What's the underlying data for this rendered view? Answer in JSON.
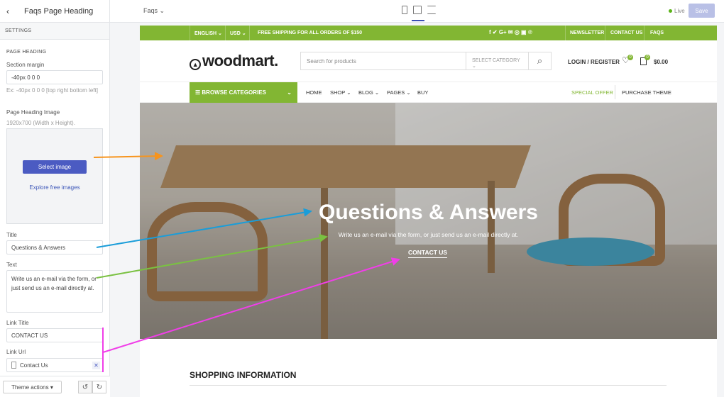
{
  "topbar": {
    "panel_title": "Faqs Page Heading",
    "page_selector": "Faqs",
    "live": "Live",
    "save": "Save"
  },
  "panel": {
    "settings": "SETTINGS",
    "section": "PAGE HEADING",
    "section_margin_label": "Section margin",
    "section_margin_value": "-40px 0 0 0",
    "section_margin_hint": "Ex: -40px 0 0 0 [top right bottom left]",
    "image_label": "Page Heading Image",
    "image_hint": "1920x700 (Width x Height).",
    "select_image": "Select image",
    "explore": "Explore free images",
    "title_label": "Title",
    "title_value": "Questions & Answers",
    "text_label": "Text",
    "text_value": "Write us an e-mail via the form, or just send us an e-mail directly at.",
    "link_title_label": "Link Title",
    "link_title_value": "CONTACT US",
    "link_url_label": "Link Url",
    "link_url_value": "Contact Us",
    "theme_actions": "Theme actions ▾"
  },
  "site": {
    "topbar": {
      "language": "ENGLISH ⌄",
      "currency": "USD ⌄",
      "shipping": "FREE SHIPPING FOR ALL ORDERS OF $150",
      "social": "f  ✔  G+  ✉  ◎  ▣  ℗",
      "links": [
        "NEWSLETTER",
        "CONTACT US",
        "FAQS"
      ]
    },
    "logo": "woodmart.",
    "search_placeholder": "Search for products",
    "category": "SELECT CATEGORY ⌄",
    "login": "LOGIN / REGISTER",
    "wishlist_count": "0",
    "cart_count": "0",
    "cart_total": "$0.00",
    "browse": "BROWSE CATEGORIES",
    "nav": [
      "HOME",
      "SHOP ⌄",
      "BLOG ⌄",
      "PAGES ⌄",
      "BUY"
    ],
    "special_offer": "SPECIAL OFFER",
    "purchase": "PURCHASE THEME",
    "hero": {
      "title": "Questions & Answers",
      "text": "Write us an e-mail via the form, or just send us an e-mail directly at.",
      "link": "CONTACT US"
    },
    "section_heading": "SHOPPING INFORMATION"
  },
  "colors": {
    "brand_green": "#82b633",
    "accent_blue": "#4b5bc2",
    "arrow_orange": "#f7941d",
    "arrow_blue": "#1a9dd9",
    "arrow_green": "#7ac142",
    "arrow_pink": "#f03ee8"
  }
}
